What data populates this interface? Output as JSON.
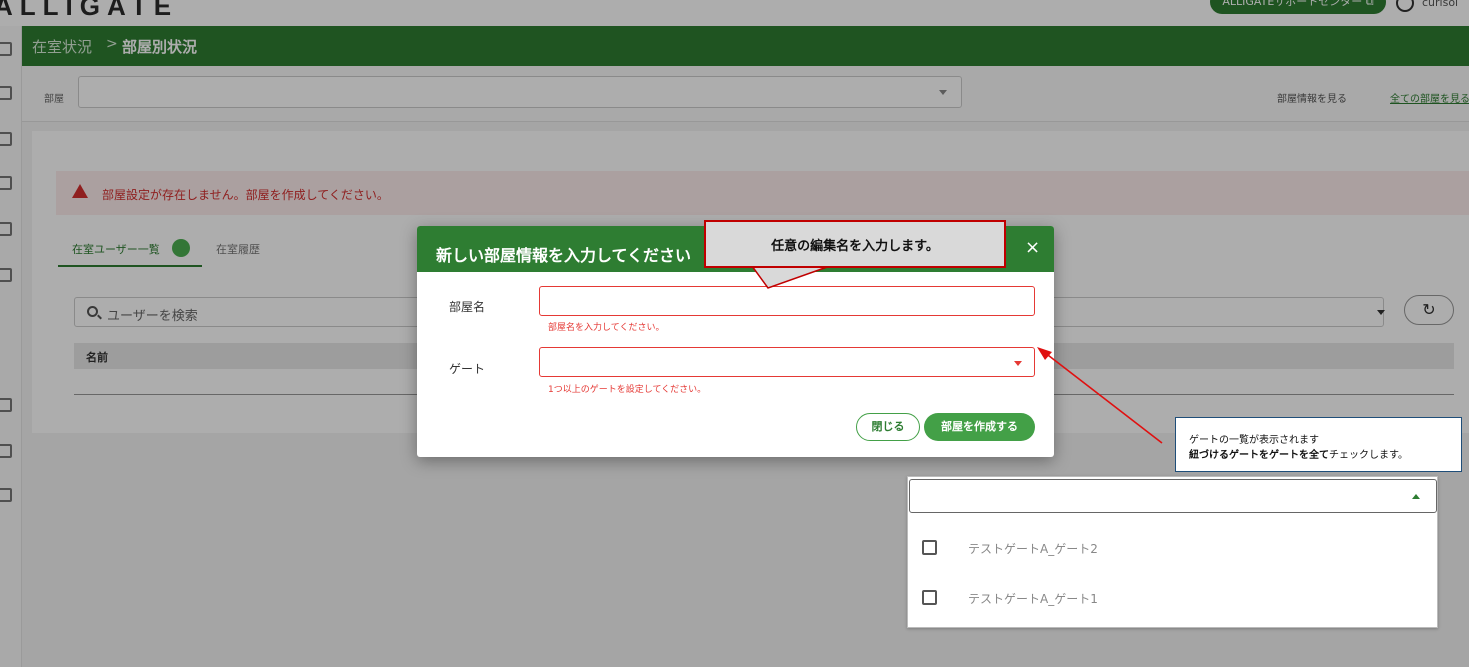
{
  "app": {
    "logo": "ALLIGATE",
    "support_label": "ALLIGATEサポートセンター ⧉",
    "user_name": "curisol"
  },
  "breadcrumb": {
    "parent": "在室状況",
    "separator": ">",
    "current": "部屋別状況"
  },
  "room_bar": {
    "label": "部屋",
    "view_info": "部屋情報を見る",
    "view_all": "全ての部屋を見る"
  },
  "alert": {
    "text": "部屋設定が存在しません。部屋を作成してください。"
  },
  "tabs": [
    {
      "label": "在室ユーザー一覧"
    },
    {
      "label": "在室履歴"
    }
  ],
  "search": {
    "placeholder": "ユーザーを検索"
  },
  "table": {
    "columns": [
      "名前"
    ]
  },
  "modal": {
    "title": "新しい部屋情報を入力してください",
    "close_icon": "×",
    "fields": [
      {
        "label": "部屋名",
        "error": "部屋名を入力してください。"
      },
      {
        "label": "ゲート",
        "error": "1つ以上のゲートを設定してください。"
      }
    ],
    "close_button": "閉じる",
    "create_button": "部屋を作成する"
  },
  "callouts": {
    "name_hint": "任意の編集名を入力します。",
    "gate_hint_line1": "ゲートの一覧が表示されます",
    "gate_hint_line2_bold": "紐づけるゲートをゲートを全て",
    "gate_hint_line2_rest": "チェックします。"
  },
  "gate_dropdown": {
    "options": [
      {
        "label": "テストゲートA_ゲート2",
        "checked": false
      },
      {
        "label": "テストゲートA_ゲート1",
        "checked": false
      }
    ]
  },
  "colors": {
    "brand_green": "#2e7d32",
    "button_green": "#43a047",
    "error_red": "#e53935",
    "callout_border": "#c00000",
    "callout_arrow": "#e01010"
  }
}
